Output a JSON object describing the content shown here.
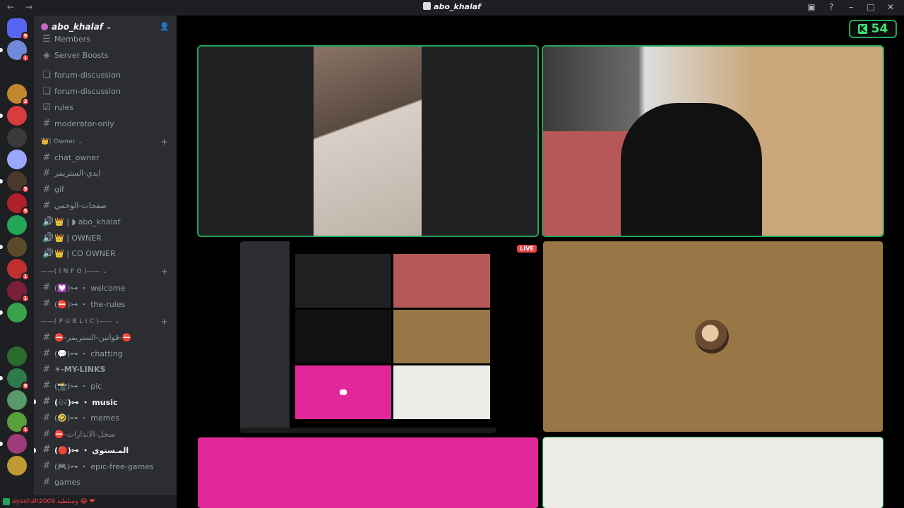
{
  "window": {
    "title": "abo_khalaf",
    "nav_arrows": "← →",
    "controls": [
      "inbox-icon",
      "help-icon",
      "minimize-icon",
      "maximize-icon",
      "close-icon"
    ]
  },
  "server": {
    "name": "abo_khalaf",
    "chevron": "⌄"
  },
  "guilds": [
    {
      "color": "#5865f2",
      "badge": "9"
    },
    {
      "color": "#7289da",
      "badge": "1"
    },
    {
      "color": "#1e1f22",
      "badge": ""
    },
    {
      "color": "#c0892d",
      "badge": "2"
    },
    {
      "color": "#d83c3e",
      "badge": ""
    },
    {
      "color": "#3a3a3a",
      "badge": ""
    },
    {
      "color": "#9aa7ff",
      "badge": ""
    },
    {
      "color": "#4a3a2e",
      "badge": "5"
    },
    {
      "color": "#b0202a",
      "badge": "5"
    },
    {
      "color": "#23a55a",
      "badge": ""
    },
    {
      "color": "#5a4a2a",
      "badge": ""
    },
    {
      "color": "#c03030",
      "badge": "1"
    },
    {
      "color": "#7a1f3a",
      "badge": "1"
    },
    {
      "color": "#3aa24a",
      "badge": ""
    },
    {
      "color": "#1e1f22",
      "badge": ""
    },
    {
      "color": "#2a6a2a",
      "badge": ""
    },
    {
      "color": "#2d7a4a",
      "badge": "8"
    },
    {
      "color": "#5a9a6a",
      "badge": ""
    },
    {
      "color": "#5aa03a",
      "badge": "1"
    },
    {
      "color": "#a03a7a",
      "badge": ""
    },
    {
      "color": "#c09a30",
      "badge": ""
    }
  ],
  "channels": {
    "top": [
      {
        "label": "Members",
        "icon": "members-icon",
        "glyph": "☰"
      },
      {
        "label": "Server Boosts",
        "icon": "boost-icon",
        "glyph": "◈"
      }
    ],
    "forums": [
      {
        "label": "forum-discussion",
        "icon": "forum-icon",
        "glyph": "❏"
      },
      {
        "label": "forum-discussion",
        "icon": "forum-icon",
        "glyph": "❏"
      },
      {
        "label": "rules",
        "icon": "rules-icon",
        "glyph": "☑"
      },
      {
        "label": "moderator-only",
        "icon": "hash-icon",
        "glyph": "#"
      }
    ],
    "owner_category": "👑| Owner ⌄",
    "owner": [
      {
        "label": "chat_owner",
        "icon": "hash-icon",
        "glyph": "#"
      },
      {
        "label": "ايدي-الستريمر",
        "icon": "hash-icon",
        "glyph": "#"
      },
      {
        "label": "gif",
        "icon": "hash-icon",
        "glyph": "#"
      },
      {
        "label": "صفحات-الوخمي",
        "icon": "hash-icon",
        "glyph": "#"
      },
      {
        "label": "👑 | ◗ abo_khalaf",
        "icon": "speaker-icon",
        "glyph": "🔊"
      },
      {
        "label": "👑 | OWNER",
        "icon": "speaker-icon",
        "glyph": "🔊"
      },
      {
        "label": "👑 | CO OWNER",
        "icon": "speaker-icon",
        "glyph": "🔊"
      }
    ],
    "info_category": "——( I N F O )—— ⌄",
    "info": [
      {
        "label": "(💟)⊶ ・ welcome",
        "icon": "hash-icon",
        "glyph": "#"
      },
      {
        "label": "(⛔)⊶ ・ the-rules",
        "icon": "hash-icon",
        "glyph": "#"
      }
    ],
    "public_category": "——( P U B L I C )—— ⌄",
    "public": [
      {
        "label": "⛔-قوانين-الستريمر-⛔",
        "icon": "hash-icon",
        "glyph": "#",
        "state": ""
      },
      {
        "label": "(💬)⊶ ・ chatting",
        "icon": "hash-icon",
        "glyph": "#",
        "state": ""
      },
      {
        "label": "✶-MY-LINKS",
        "icon": "hash-icon",
        "glyph": "#",
        "state": "bold"
      },
      {
        "label": "(📸)⊶ ・ pic",
        "icon": "hash-icon",
        "glyph": "#",
        "state": ""
      },
      {
        "label": "(🎶)⊶ ・ music",
        "icon": "hash-icon",
        "glyph": "#",
        "state": "active"
      },
      {
        "label": "(🤣)⊶ ・ memes",
        "icon": "hash-icon",
        "glyph": "#",
        "state": ""
      },
      {
        "label": "⛔-سجل-الانذارات",
        "icon": "hash-icon",
        "glyph": "#",
        "state": "dim"
      },
      {
        "label": "(🔴)⊶ ・ المـستوى",
        "icon": "hash-icon",
        "glyph": "#",
        "state": "active"
      },
      {
        "label": "(🎮)⊶ ・ epic-free-games",
        "icon": "hash-icon",
        "glyph": "#",
        "state": ""
      },
      {
        "label": "games",
        "icon": "hash-icon",
        "glyph": "#",
        "state": ""
      }
    ]
  },
  "user_strip": {
    "text": "ayashah2009 وسلطيه 😂 ❤"
  },
  "stage": {
    "counter_value": "54",
    "counter_letter": "K",
    "live_label": "LIVE",
    "tiles": {
      "cam_left_bg": "#1e2022",
      "cam_right_bg": "#c9a77a",
      "screen_bg": "#000000",
      "avatar_bg": "#987646",
      "pink_bg": "#e0289a",
      "light_bg": "#ecebe6"
    }
  }
}
